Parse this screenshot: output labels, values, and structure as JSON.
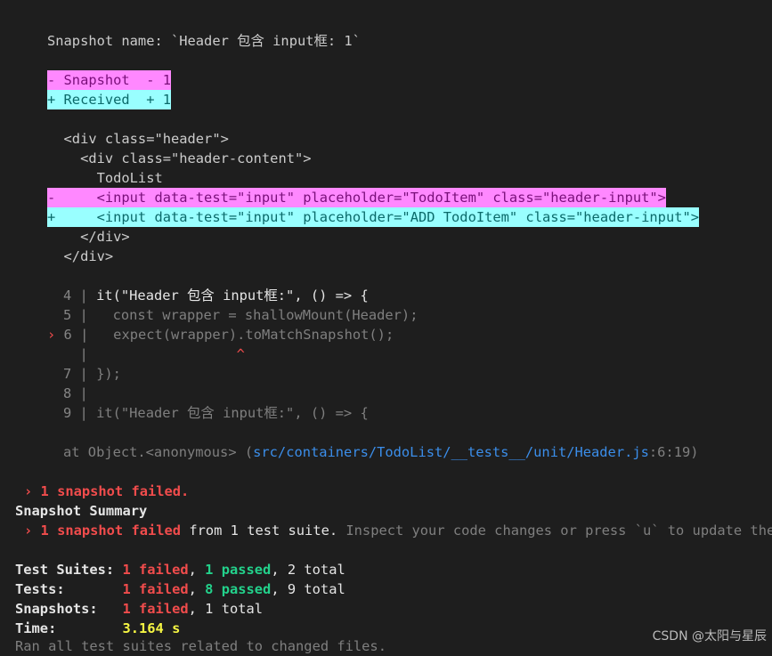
{
  "snapshot_name_line": "Snapshot name: `Header 包含 input框: 1`",
  "legend": {
    "snapshot": "- Snapshot  - 1",
    "received": "+ Received  + 1"
  },
  "diff_lines": [
    "  <div class=\"header\">",
    "    <div class=\"header-content\">",
    "      TodoList",
    "-     <input data-test=\"input\" placeholder=\"TodoItem\" class=\"header-input\">",
    "+     <input data-test=\"input\" placeholder=\"ADD TodoItem\" class=\"header-input\">",
    "    </div>",
    "  </div>"
  ],
  "code_frame": {
    "line4_num": "4",
    "line4_code": "it(\"Header 包含 input框:\", () => {",
    "line5_num": "5",
    "line5_code": "  const wrapper = shallowMount(Header);",
    "line6_num": "6",
    "line6_code": "  expect(wrapper).toMatchSnapshot();",
    "caret": "^",
    "line7_num": "7",
    "line7_code": "});",
    "line8_num": "8",
    "line9_num": "9",
    "line9_code": "it(\"Header 包含 input框:\", () => {"
  },
  "stack": {
    "prefix": "at Object.<anonymous> (",
    "path": "src/containers/TodoList/__tests__/unit/Header.js",
    "loc": ":6:19)"
  },
  "failed_line": "› 1 snapshot failed.",
  "summary_title": "Snapshot Summary",
  "summary_line": {
    "failed": "› 1 snapshot failed",
    "from": " from 1 test suite.",
    "hint": " Inspect your code changes or press `u` to update them."
  },
  "stats": {
    "suites_label": "Test Suites:",
    "suites_failed": "1 failed",
    "suites_passed": "1 passed",
    "suites_total": "2 total",
    "tests_label": "Tests:",
    "tests_failed": "1 failed",
    "tests_passed": "8 passed",
    "tests_total": "9 total",
    "snaps_label": "Snapshots:",
    "snaps_failed": "1 failed",
    "snaps_total": "1 total",
    "time_label": "Time:",
    "time_value": "3.164 s",
    "ran_all": "Ran all test suites related to changed files."
  },
  "watermark": "CSDN @太阳与星辰",
  "colors": {
    "background": "#1e1e1e",
    "snapshot_bg": "#ff88ff",
    "received_bg": "#99ffff",
    "failed": "#f14c4c",
    "passed": "#23d18b",
    "time": "#f5f543"
  }
}
